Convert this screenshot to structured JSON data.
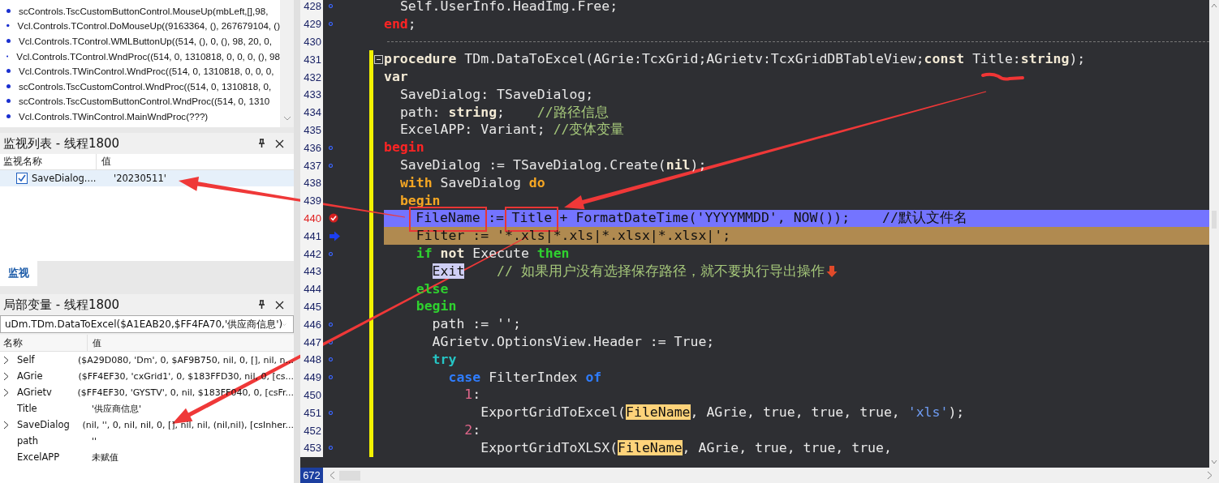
{
  "call_stack": {
    "frames": [
      {
        "text": "scControls.TscCustomButtonControl.MouseUp(mbLeft,[],98,"
      },
      {
        "text": "Vcl.Controls.TControl.DoMouseUp((9163364, (), 267679104, ()"
      },
      {
        "text": "Vcl.Controls.TControl.WMLButtonUp((514, (), 0, (), 98, 20, 0,"
      },
      {
        "text": "Vcl.Controls.TControl.WndProc((514, 0, 1310818, 0, 0, 0, (), 98"
      },
      {
        "text": "Vcl.Controls.TWinControl.WndProc((514, 0, 1310818, 0, 0, 0,"
      },
      {
        "text": "scControls.TscCustomControl.WndProc((514, 0, 1310818, 0,"
      },
      {
        "text": "scControls.TscCustomButtonControl.WndProc((514, 0, 1310"
      },
      {
        "text": "Vcl.Controls.TWinControl.MainWndProc(???)"
      }
    ]
  },
  "watch_panel": {
    "title": "监视列表 - 线程1800",
    "columns": [
      "监视名称",
      "值"
    ],
    "rows": [
      {
        "name": "SaveDialog....",
        "value": "'20230511'",
        "checked": true,
        "selected": true
      }
    ],
    "tabs": [
      {
        "label": "监视",
        "selected": true
      }
    ]
  },
  "locals_panel": {
    "title": "局部变量 - 线程1800",
    "frame_select": "uDm.TDm.DataToExcel($A1EAB20,$FF4FA70,'供应商信息')",
    "columns": [
      "名称",
      "值"
    ],
    "rows": [
      {
        "name": "Self",
        "value": "($A29D080, 'Dm', 0, $AF9B750, nil, 0, [], nil, n...",
        "expandable": true
      },
      {
        "name": "AGrie",
        "value": "($FF4EF30, 'cxGrid1', 0, $183FFD30, nil, 0, [cs...",
        "expandable": true
      },
      {
        "name": "AGrietv",
        "value": "($FF4EF30, 'GYSTV', 0, nil, $183FF040, 0, [csFr...",
        "expandable": true
      },
      {
        "name": "Title",
        "value": "'供应商信息'",
        "expandable": false
      },
      {
        "name": "SaveDialog",
        "value": "(nil, '', 0, nil, nil, 0, [], nil, nil, (nil,nil), [csInher...",
        "expandable": true
      },
      {
        "name": "path",
        "value": "''",
        "expandable": false
      },
      {
        "name": "ExcelAPP",
        "value": "未赋值",
        "expandable": false
      }
    ]
  },
  "editor": {
    "status": "672",
    "lines": [
      {
        "n": "428",
        "kind": "code",
        "marker": {
          "kind": "dot"
        },
        "modified": false,
        "tokens": [
          {
            "text": "  Self.UserInfo.HeadImg.Free;",
            "kind": "plain"
          }
        ]
      },
      {
        "n": "429",
        "kind": "code",
        "marker": {
          "kind": "dot"
        },
        "modified": false,
        "tokens": [
          {
            "text": "end",
            "kind": "red"
          },
          {
            "text": ";",
            "kind": "plain"
          }
        ]
      },
      {
        "n": "430",
        "kind": "separator",
        "modified": false
      },
      {
        "n": "431",
        "kind": "code",
        "fold": true,
        "modified": true,
        "tokens": [
          {
            "text": "procedure",
            "kind": "bold"
          },
          {
            "text": " TDm.DataToExcel(AGrie:TcxGrid;AGrietv:TcxGridDBTableView;",
            "kind": "plain"
          },
          {
            "text": "const",
            "kind": "bold"
          },
          {
            "text": " Title:",
            "kind": "plain"
          },
          {
            "text": "string",
            "kind": "bold"
          },
          {
            "text": ");",
            "kind": "plain"
          }
        ]
      },
      {
        "n": "432",
        "kind": "code",
        "modified": true,
        "tokens": [
          {
            "text": "var",
            "kind": "bold"
          }
        ]
      },
      {
        "n": "433",
        "kind": "code",
        "modified": true,
        "tokens": [
          {
            "text": "  SaveDialog: TSaveDialog;",
            "kind": "plain"
          }
        ]
      },
      {
        "n": "434",
        "kind": "code",
        "modified": true,
        "tokens": [
          {
            "text": "  path: ",
            "kind": "plain"
          },
          {
            "text": "string",
            "kind": "bold"
          },
          {
            "text": ";    ",
            "kind": "plain"
          },
          {
            "text": "//路径信息",
            "kind": "comment"
          }
        ]
      },
      {
        "n": "435",
        "kind": "code",
        "modified": true,
        "tokens": [
          {
            "text": "  ExcelAPP: Variant; ",
            "kind": "plain"
          },
          {
            "text": "//变体变量",
            "kind": "comment"
          }
        ]
      },
      {
        "n": "436",
        "kind": "code",
        "marker": {
          "kind": "dot"
        },
        "modified": true,
        "tokens": [
          {
            "text": "begin",
            "kind": "red"
          }
        ]
      },
      {
        "n": "437",
        "kind": "code",
        "marker": {
          "kind": "dot"
        },
        "modified": true,
        "tokens": [
          {
            "text": "  SaveDialog := TSaveDialog.Create(",
            "kind": "plain"
          },
          {
            "text": "nil",
            "kind": "bold"
          },
          {
            "text": ");",
            "kind": "plain"
          }
        ]
      },
      {
        "n": "438",
        "kind": "code",
        "modified": true,
        "tokens": [
          {
            "text": "  with",
            "kind": "orange"
          },
          {
            "text": " SaveDialog ",
            "kind": "plain"
          },
          {
            "text": "do",
            "kind": "orange"
          }
        ]
      },
      {
        "n": "439",
        "kind": "code",
        "modified": true,
        "tokens": [
          {
            "text": "  begin",
            "kind": "orange"
          }
        ]
      },
      {
        "n": "440",
        "kind": "code",
        "marker": {
          "kind": "breakpoint"
        },
        "highlight": {
          "kind": "breakpoint"
        },
        "modified": true,
        "tokens": [
          {
            "text": "    FileName",
            "kind": "plain",
            "boxed": true
          },
          {
            "text": " := ",
            "kind": "plain"
          },
          {
            "text": "Title",
            "kind": "plain",
            "boxed": true
          },
          {
            "text": " + FormatDateTime('YYYYMMDD', NOW());",
            "kind": "plain"
          },
          {
            "text": "    //默认文件名",
            "kind": "comment"
          }
        ]
      },
      {
        "n": "441",
        "kind": "code",
        "marker": {
          "kind": "arrow"
        },
        "highlight": {
          "kind": "execution"
        },
        "modified": true,
        "tokens": [
          {
            "text": "    Filter := '*.xls|*.xls|*.xlsx|*.xlsx|';",
            "kind": "plain"
          }
        ]
      },
      {
        "n": "442",
        "kind": "code",
        "marker": {
          "kind": "dot"
        },
        "modified": true,
        "tokens": [
          {
            "text": "    if",
            "kind": "green"
          },
          {
            "text": " not",
            "kind": "bold"
          },
          {
            "text": " Execute ",
            "kind": "plain"
          },
          {
            "text": "then",
            "kind": "green"
          }
        ]
      },
      {
        "n": "443",
        "kind": "code",
        "modified": true,
        "note_icon": true,
        "tokens": [
          {
            "text": "      Exit",
            "kind": "selection"
          },
          {
            "text": "    // 如果用户没有选择保存路径，就不要执行导出操作",
            "kind": "comment"
          }
        ]
      },
      {
        "n": "444",
        "kind": "code",
        "modified": true,
        "tokens": [
          {
            "text": "    else",
            "kind": "green"
          }
        ]
      },
      {
        "n": "445",
        "kind": "code",
        "modified": true,
        "tokens": [
          {
            "text": "    begin",
            "kind": "green"
          }
        ]
      },
      {
        "n": "446",
        "kind": "code",
        "marker": {
          "kind": "dot"
        },
        "modified": true,
        "tokens": [
          {
            "text": "      path := '';",
            "kind": "plain"
          }
        ]
      },
      {
        "n": "447",
        "kind": "code",
        "marker": {
          "kind": "dot"
        },
        "modified": true,
        "tokens": [
          {
            "text": "      AGrietv.OptionsView.Header := True;",
            "kind": "plain"
          }
        ]
      },
      {
        "n": "448",
        "kind": "code",
        "marker": {
          "kind": "dot"
        },
        "modified": true,
        "tokens": [
          {
            "text": "      try",
            "kind": "cyan"
          }
        ]
      },
      {
        "n": "449",
        "kind": "code",
        "marker": {
          "kind": "dot"
        },
        "modified": true,
        "tokens": [
          {
            "text": "        case",
            "kind": "blue"
          },
          {
            "text": " FilterIndex ",
            "kind": "plain"
          },
          {
            "text": "of",
            "kind": "blue"
          }
        ]
      },
      {
        "n": "450",
        "kind": "code",
        "modified": true,
        "tokens": [
          {
            "text": "          1",
            "kind": "number"
          },
          {
            "text": ":",
            "kind": "plain"
          }
        ]
      },
      {
        "n": "451",
        "kind": "code",
        "marker": {
          "kind": "dot"
        },
        "modified": true,
        "tokens": [
          {
            "text": "            ExportGridToExcel(",
            "kind": "plain"
          },
          {
            "text": "FileName",
            "kind": "match"
          },
          {
            "text": ", AGrie, true, true, true, ",
            "kind": "plain"
          },
          {
            "text": "'xls'",
            "kind": "string"
          },
          {
            "text": ");",
            "kind": "plain"
          }
        ]
      },
      {
        "n": "452",
        "kind": "code",
        "modified": true,
        "tokens": [
          {
            "text": "          2",
            "kind": "number"
          },
          {
            "text": ":",
            "kind": "plain"
          }
        ]
      },
      {
        "n": "453",
        "kind": "code",
        "marker": {
          "kind": "dot"
        },
        "modified": true,
        "tokens": [
          {
            "text": "            ExportGridToXLSX(",
            "kind": "plain"
          },
          {
            "text": "FileName",
            "kind": "match"
          },
          {
            "text": ", AGrie, true, true, true,",
            "kind": "plain"
          }
        ]
      }
    ]
  }
}
